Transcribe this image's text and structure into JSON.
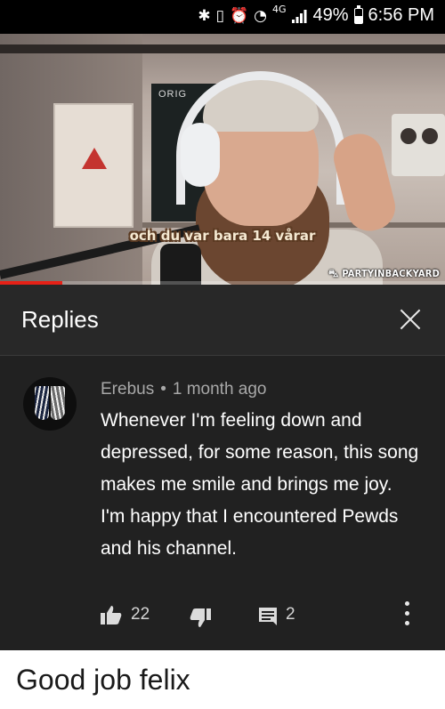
{
  "status_bar": {
    "network": "4G",
    "battery": "49%",
    "battery_level": 0.49,
    "time": "6:56 PM"
  },
  "video": {
    "subtitle": "och du var bara 14 vårar",
    "channel_tag": "PARTYINBACKYARD",
    "poster_text": "ORIG",
    "progress": 0.14
  },
  "replies_panel": {
    "title": "Replies",
    "close_icon": "close-icon"
  },
  "comment": {
    "author": "Erebus",
    "separator": "•",
    "time_ago": "1 month ago",
    "text": "Whenever I'm feeling down and depressed, for some reason, this song makes me smile and brings me joy. I'm happy that I encountered Pewds and his channel.",
    "likes": "22",
    "replies": "2",
    "icons": [
      "thumbs-up-icon",
      "thumbs-down-icon",
      "reply-icon",
      "more-vertical-icon"
    ]
  },
  "caption": "Good job felix",
  "colors": {
    "panel_bg": "#212121",
    "header_bg": "#282828",
    "progress_red": "#e62117"
  }
}
